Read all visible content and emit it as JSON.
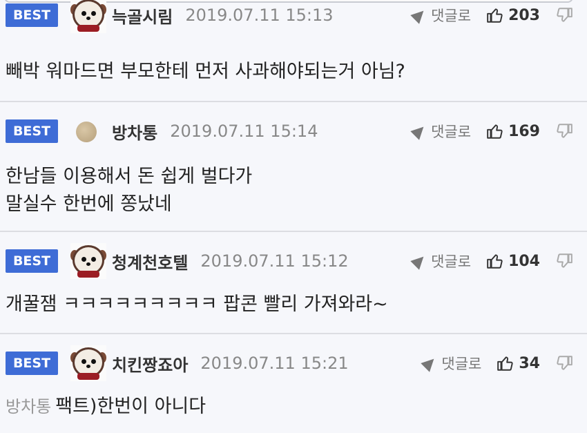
{
  "comments": [
    {
      "badge": "BEST",
      "avatar": "dog-avatar",
      "name": "늑골시림",
      "date": "2019.07.11 15:13",
      "reply_label": "댓글로",
      "likes": "203",
      "lines": [
        "빼박 워마드면 부모한테 먼저 사과해야되는거 아님?"
      ]
    },
    {
      "badge": "BEST",
      "avatar": "round-avatar",
      "name": "방차통",
      "date": "2019.07.11 15:14",
      "reply_label": "댓글로",
      "likes": "169",
      "lines": [
        "한남들 이용해서 돈 쉽게 벌다가",
        "말실수 한번에 쫑났네"
      ]
    },
    {
      "badge": "BEST",
      "avatar": "dog-avatar",
      "name": "청계천호텔",
      "date": "2019.07.11 15:12",
      "reply_label": "댓글로",
      "likes": "104",
      "lines": [
        "개꿀잼 ㅋㅋㅋㅋㅋㅋㅋㅋㅋ 팝콘 빨리 가져와라~"
      ]
    },
    {
      "badge": "BEST",
      "avatar": "dog-avatar",
      "name": "치킨짱죠아",
      "date": "2019.07.11 15:21",
      "reply_label": "댓글로",
      "likes": "34",
      "mention": "방차통",
      "lines": [
        "팩트)한번이 아니다"
      ]
    }
  ]
}
